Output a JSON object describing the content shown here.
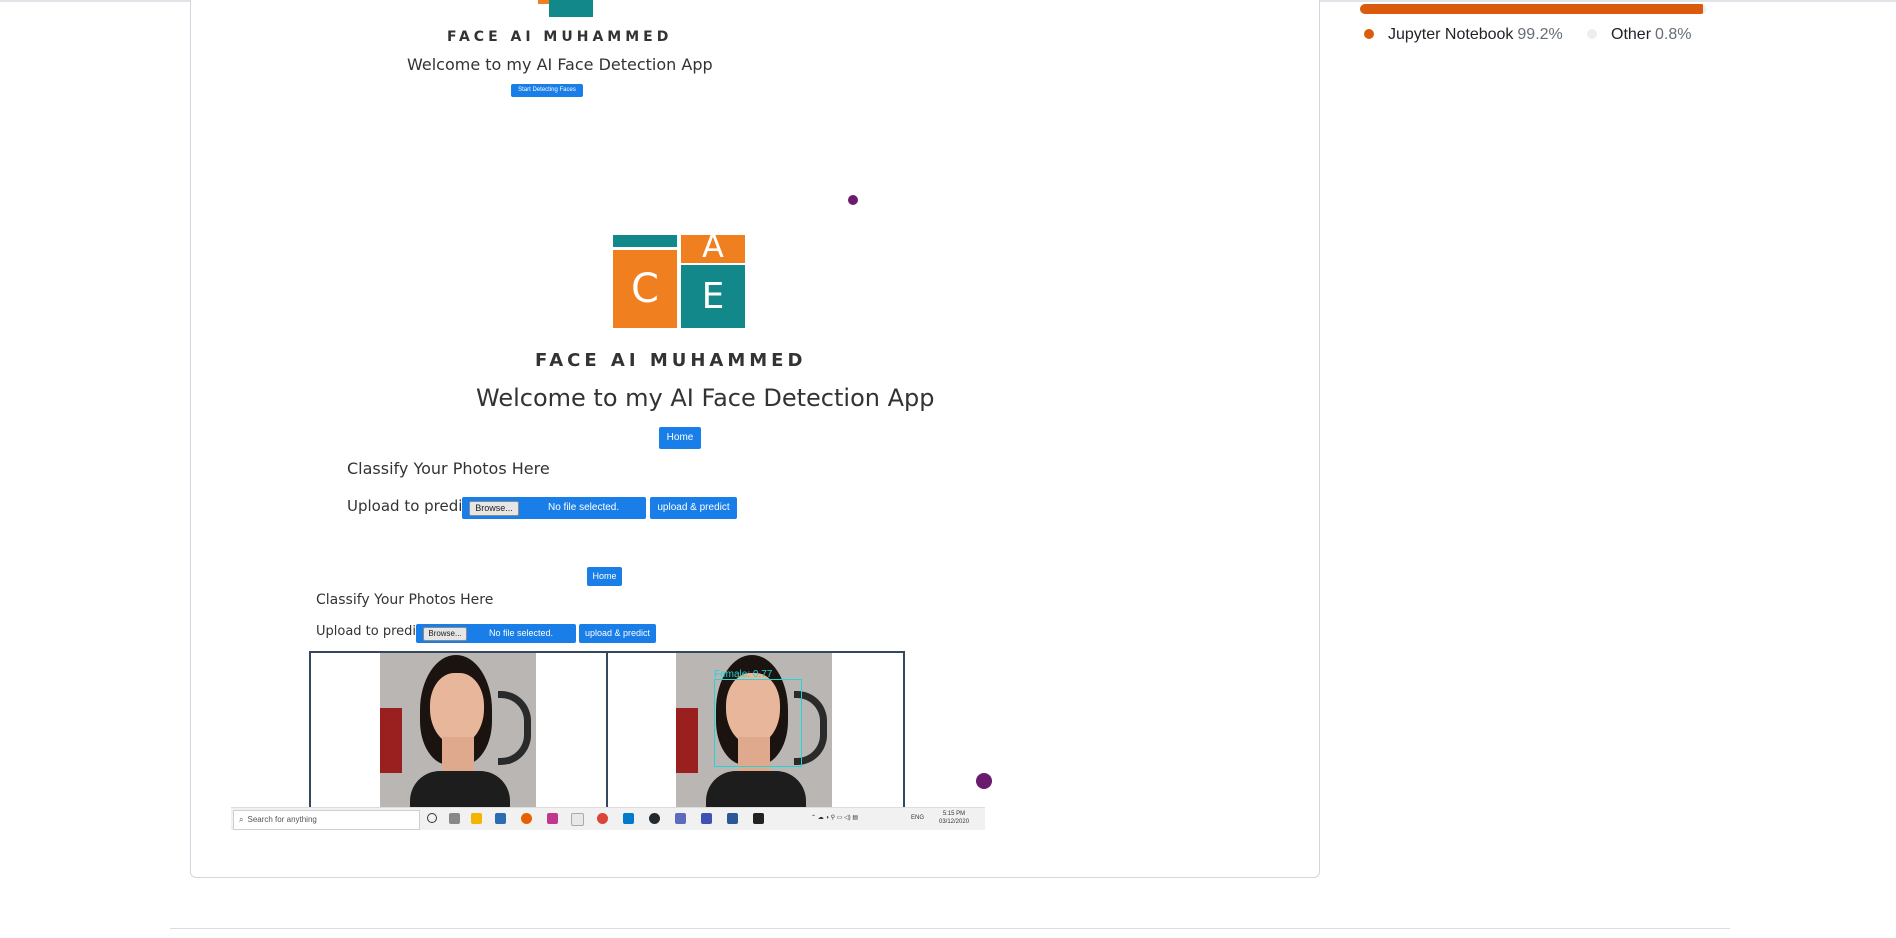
{
  "languages": {
    "items": [
      {
        "name": "Jupyter Notebook",
        "percent": "99.2%",
        "color": "#da5b0b",
        "value": 99.2
      },
      {
        "name": "Other",
        "percent": "0.8%",
        "color": "#ededed",
        "value": 0.8
      }
    ]
  },
  "readme_image": {
    "top_section": {
      "brand": "FACE AI MUHAMMED",
      "welcome": "Welcome to my AI Face Detection App",
      "start_button": "Start Detecting Faces"
    },
    "middle_section": {
      "logo_letters": [
        "C",
        "A",
        "E"
      ],
      "brand": "FACE AI MUHAMMED",
      "welcome": "Welcome to my AI Face Detection App",
      "home_button": "Home",
      "classify_heading": "Classify Your Photos Here",
      "upload_label": "Upload to predict",
      "browse_button": "Browse...",
      "file_status": "No file selected.",
      "predict_button": "upload & predict"
    },
    "bottom_section": {
      "home_button": "Home",
      "classify_heading": "Classify Your Photos Here",
      "upload_label": "Upload to predict",
      "browse_button": "Browse...",
      "file_status": "No file selected.",
      "predict_button": "upload & predict",
      "detection_label": "Female: 0.77"
    },
    "taskbar": {
      "search_placeholder": "Search for anything",
      "lang": "ENG",
      "time": "5:15 PM",
      "date": "03/12/2020"
    }
  }
}
